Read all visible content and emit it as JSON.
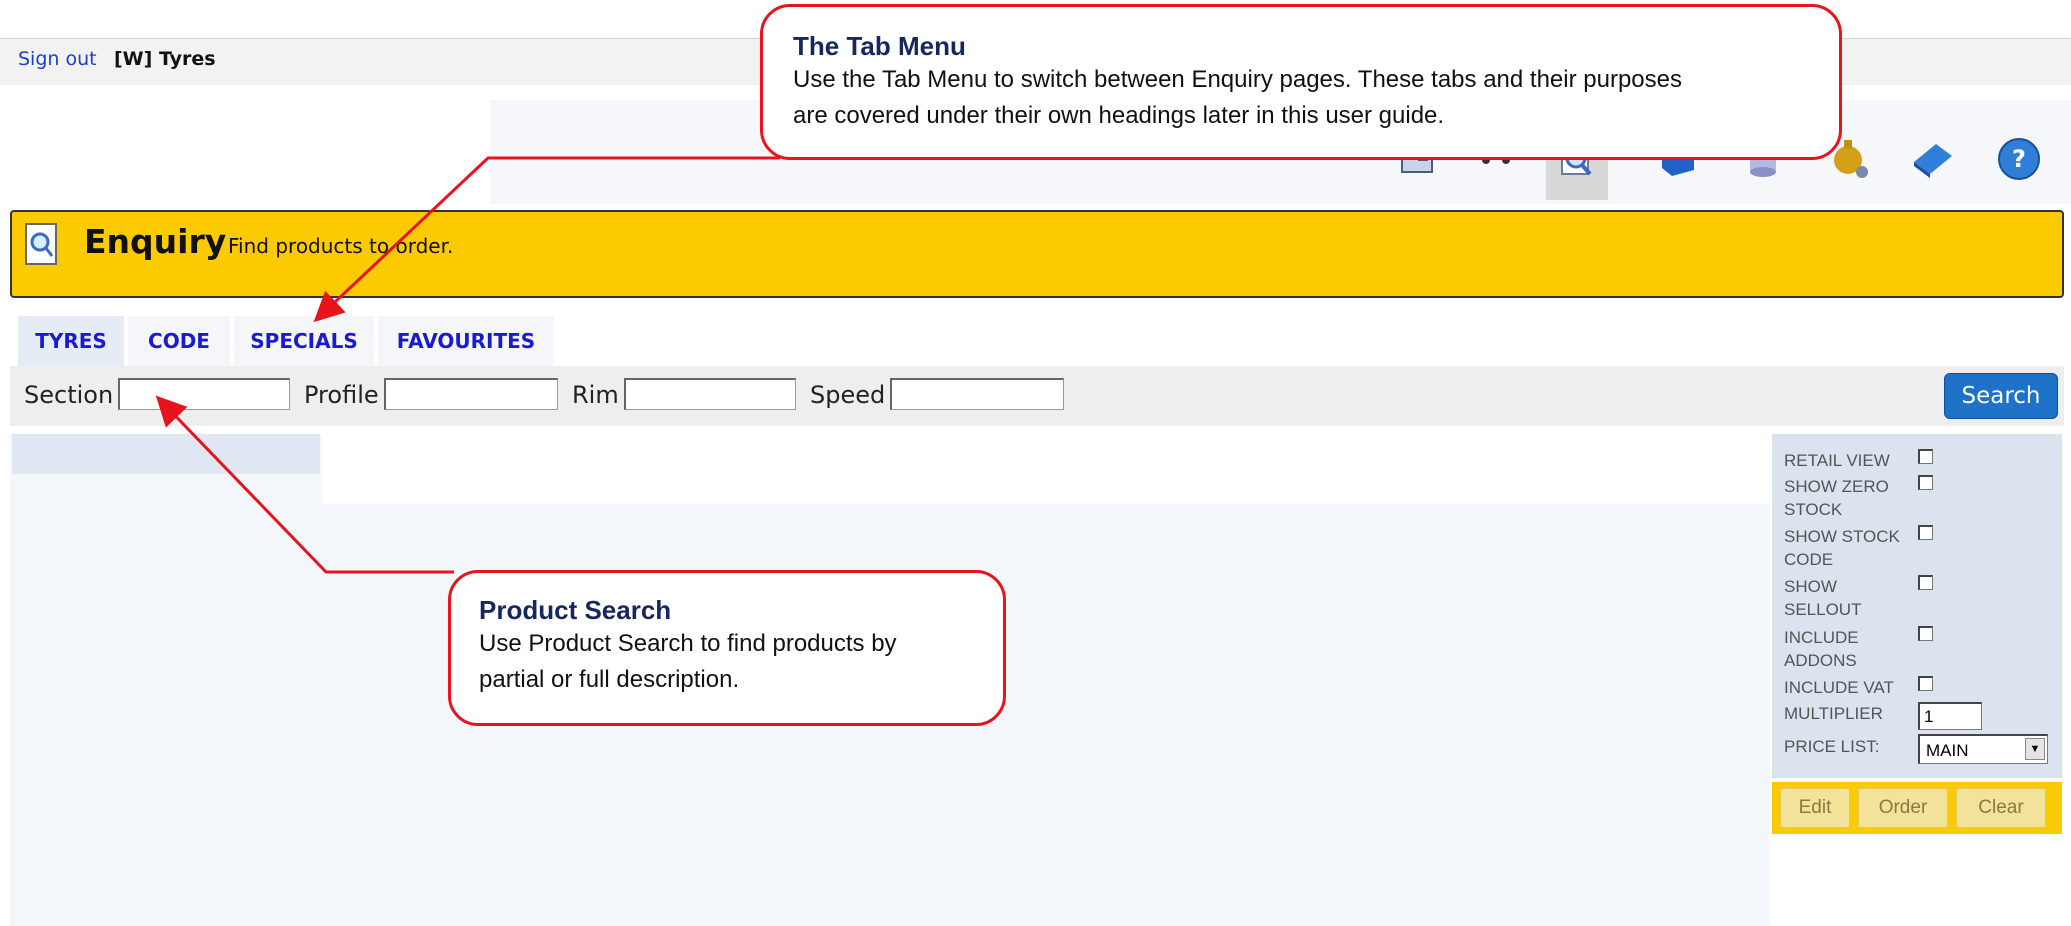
{
  "header": {
    "sign_out": "Sign out",
    "user": "[W] Tyres"
  },
  "toolbar_icons": [
    "document-icon",
    "vehicle-icon",
    "enquiry-icon",
    "cube-icon",
    "database-icon",
    "money-bag-icon",
    "book-icon",
    "help-icon"
  ],
  "banner": {
    "title": "Enquiry",
    "subtitle": "Find products to order."
  },
  "tabs": [
    {
      "label": "TYRES"
    },
    {
      "label": "CODE"
    },
    {
      "label": "SPECIALS"
    },
    {
      "label": "FAVOURITES"
    }
  ],
  "search": {
    "fields": [
      {
        "label": "Section",
        "value": ""
      },
      {
        "label": "Profile",
        "value": ""
      },
      {
        "label": "Rim",
        "value": ""
      },
      {
        "label": "Speed",
        "value": ""
      }
    ],
    "button": "Search"
  },
  "options": {
    "retail_view": "RETAIL VIEW",
    "show_zero_stock": "SHOW ZERO STOCK",
    "show_stock_code": "SHOW STOCK CODE",
    "show_sellout": "SHOW SELLOUT",
    "include_addons": "INCLUDE ADDONS",
    "include_vat": "INCLUDE VAT",
    "multiplier_label": "MULTIPLIER",
    "multiplier_value": "1",
    "price_list_label": "PRICE LIST:",
    "price_list_value": "MAIN"
  },
  "actions": {
    "edit": "Edit",
    "order": "Order",
    "clear": "Clear"
  },
  "callouts": {
    "tab_menu": {
      "title": "The Tab Menu",
      "line1": "Use the Tab Menu to switch between Enquiry pages. These tabs and their purposes",
      "line2": "are covered under their own headings later in this user guide."
    },
    "product_search": {
      "title": "Product Search",
      "line1": "Use Product Search to find products by",
      "line2": "partial or full description."
    }
  },
  "colors": {
    "accent_yellow": "#fcca00",
    "link_blue": "#1a1ad0",
    "callout_red": "#e8141c",
    "search_blue": "#1e73c8"
  }
}
